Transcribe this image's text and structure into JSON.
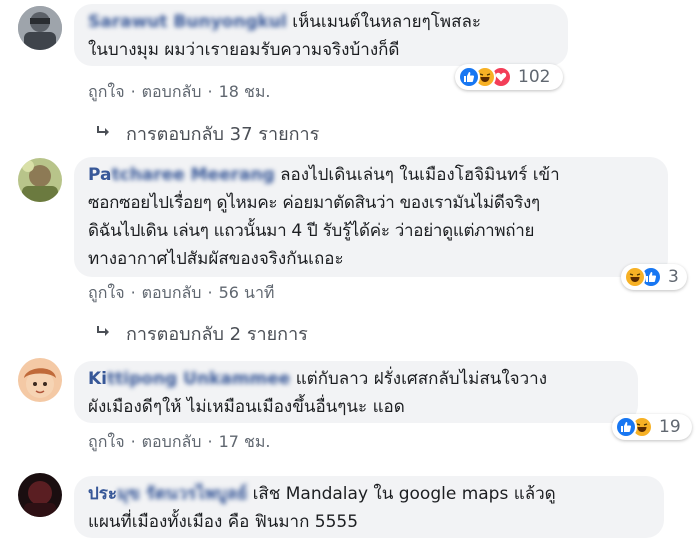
{
  "comments": [
    {
      "author": "Sarawut Bunyongkul",
      "text_lines": [
        "เห็นเมนต์ในหลายๆโพสละ",
        "ในบางมุม ผมว่าเรายอมรับความจริงบ้างก็ดี"
      ],
      "like": "ถูกใจ",
      "reply": "ตอบกลับ",
      "time": "18 ชม.",
      "reactions": [
        "like",
        "haha",
        "love"
      ],
      "reaction_count": "102",
      "replies": "การตอบกลับ 37 รายการ"
    },
    {
      "author_first": "Pa",
      "author_rest": "tcharee Meerang",
      "text_lines": [
        "ลองไปเดินเล่นๆ ในเมืองโฮจิมินทร์ เข้า",
        "ซอกซอยไปเรื่อยๆ ดูไหมคะ ค่อยมาตัดสินว่า ของเรามันไม่ดีจริงๆ",
        "ดิฉันไปเดิน เล่นๆ แถวนั้นมา 4 ปี รับรู้ได้ค่ะ ว่าอย่าดูแต่ภาพถ่าย",
        "ทางอากาศไปสัมผัสของจริงกันเถอะ"
      ],
      "like": "ถูกใจ",
      "reply": "ตอบกลับ",
      "time": "56 นาที",
      "reactions": [
        "haha",
        "like"
      ],
      "reaction_count": "3",
      "replies": "การตอบกลับ 2 รายการ"
    },
    {
      "author_first": "Ki",
      "author_rest": "ttipong Unkammee",
      "text_lines": [
        "แต่กับลาว ฝรั่งเศสกลับไม่สนใจวาง",
        "ผังเมืองดีๆให้ ไม่เหมือนเมืองขึ้นอื่นๆนะ แอด"
      ],
      "like": "ถูกใจ",
      "reply": "ตอบกลับ",
      "time": "17 ชม.",
      "reactions": [
        "like",
        "haha"
      ],
      "reaction_count": "19"
    },
    {
      "author_first": "ประ",
      "author_rest": "มุข รัตนวรไพบูลย์",
      "text_lines": [
        "เสิช Mandalay ใน google maps แล้วดู",
        "แผนที่เมืองทั้งเมือง คือ ฟินมาก 5555"
      ]
    }
  ],
  "colors": {
    "author": "#385898",
    "bubble": "#f2f3f5",
    "meta": "#606770",
    "like_blue": "#1877f2",
    "haha_yellow": "#f7b125",
    "love_red": "#f33e58"
  }
}
